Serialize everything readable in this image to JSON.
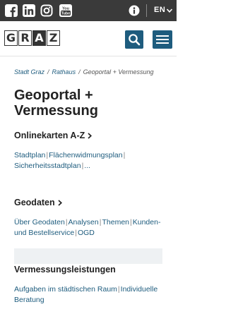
{
  "topbar": {
    "icons": [
      "facebook-icon",
      "linkedin-icon",
      "instagram-icon",
      "youtube-icon",
      "info-icon"
    ],
    "language": "EN"
  },
  "header": {
    "logo_letters": [
      "G",
      "R",
      "A",
      "Z"
    ]
  },
  "breadcrumb": {
    "items": [
      "Stadt Graz",
      "Rathaus",
      "Geoportal + Vermessung"
    ],
    "separator": "/"
  },
  "page_title": "Geoportal + Vermessung",
  "sections": [
    {
      "heading": "Onlinekarten A-Z",
      "links": [
        "Stadtplan",
        "Flächenwidmungsplan",
        "Sicherheitsstadtplan",
        "..."
      ]
    },
    {
      "heading": "Geodaten",
      "links": [
        "Über Geodaten",
        "Analysen",
        "Themen",
        "Kunden- und Bestellservice",
        "OGD"
      ]
    },
    {
      "heading": "Vermessungsleistungen",
      "links": [
        "Aufgaben im städtischen Raum",
        "Individuelle Beratung"
      ]
    }
  ],
  "colors": {
    "topbar_bg": "#3a3a3a",
    "accent": "#1e5c7e",
    "link": "#1e5c7e"
  }
}
